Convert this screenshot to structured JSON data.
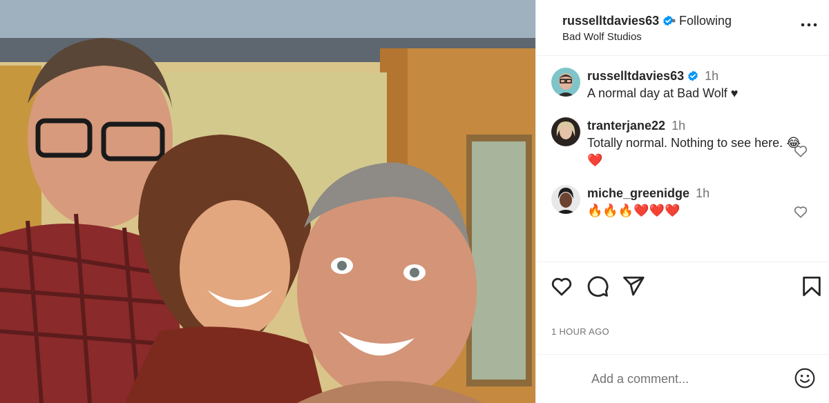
{
  "post": {
    "username": "russelltdavies63",
    "separator": "•",
    "follow_status": "Following",
    "location": "Bad Wolf Studios",
    "photo_description_alt": ""
  },
  "comments": [
    {
      "username": "russelltdavies63",
      "time": "1h",
      "text": "A normal day at Bad Wolf ♥",
      "verified": true
    },
    {
      "username": "tranterjane22",
      "time": "1h",
      "text": "Totally normal. Nothing to see here. 😂❤️"
    },
    {
      "username": "miche_greenidge",
      "time": "1h",
      "text": "🔥🔥🔥❤️❤️❤️"
    }
  ],
  "actions": {
    "like": "heart-icon",
    "comment": "comment-icon",
    "share": "send-icon",
    "save": "bookmark-icon"
  },
  "timestamp": "1 HOUR AGO",
  "add_comment": {
    "placeholder": "Add a comment..."
  },
  "colors": {
    "verified": "#0095f6",
    "border": "#efefef",
    "secondary_text": "#737373",
    "heart_red": "#ed4956"
  }
}
